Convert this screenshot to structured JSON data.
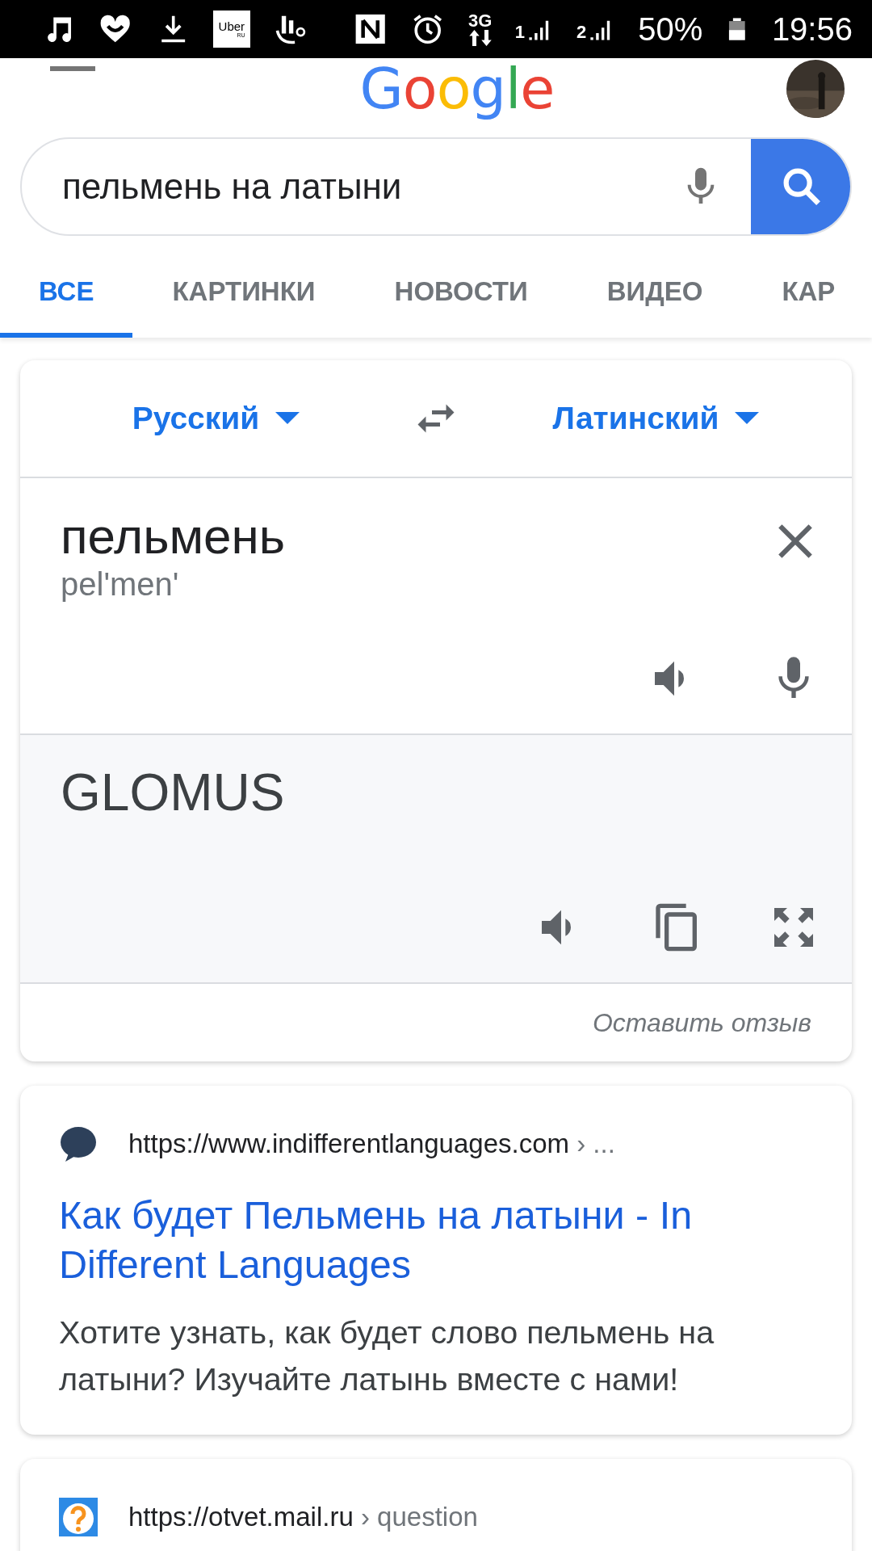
{
  "status_bar": {
    "uber_icon": {
      "name": "Uber",
      "region": "RU"
    },
    "network": "3G",
    "sim_1": "1",
    "sim_2": "2",
    "battery": "50%",
    "time": "19:56"
  },
  "header": {
    "logo": "Google"
  },
  "search": {
    "value": "пельмень на латыни"
  },
  "tabs": [
    {
      "label": "ВСЕ",
      "selected": true
    },
    {
      "label": "КАРТИНКИ",
      "selected": false
    },
    {
      "label": "НОВОСТИ",
      "selected": false
    },
    {
      "label": "ВИДЕО",
      "selected": false
    },
    {
      "label": "КАР",
      "selected": false
    }
  ],
  "translator": {
    "source_language": "Русский",
    "target_language": "Латинский",
    "source_text": "пельмень",
    "transliteration": "pel'men'",
    "translation": "GLOMUS",
    "feedback": "Оставить отзыв"
  },
  "results": [
    {
      "kind": "bubble",
      "url": "https://www.indifferentlanguages.com",
      "path": "› ...",
      "title": "Как будет Пельмень на латыни - In Different Languages",
      "snippet": "Хотите узнать, как будет слово пельмень на латыни? Изучайте латынь вместе с нами!"
    },
    {
      "kind": "question",
      "url": "https://otvet.mail.ru",
      "path": "› question"
    }
  ]
}
